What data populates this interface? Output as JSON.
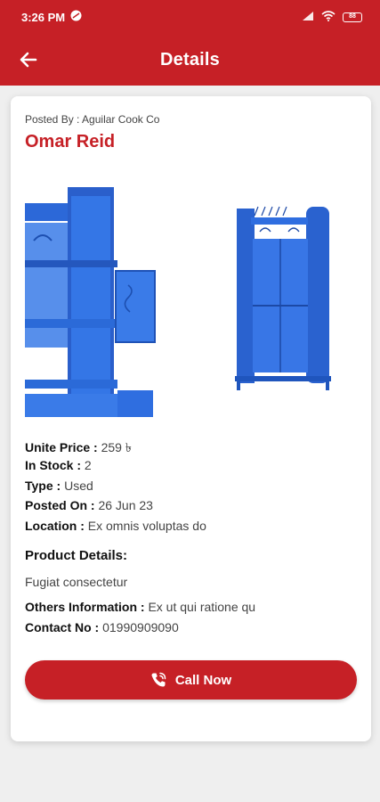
{
  "status_bar": {
    "time": "3:26 PM",
    "battery": "88"
  },
  "header": {
    "title": "Details"
  },
  "post": {
    "posted_by_label": "Posted By : ",
    "posted_by": "Aguilar Cook Co",
    "seller_name": "Omar Reid",
    "unit_price_label": "Unite Price : ",
    "unit_price": "259 ৳",
    "in_stock_label": "In Stock : ",
    "in_stock": "2",
    "type_label": "Type : ",
    "type": "Used",
    "posted_on_label": "Posted On : ",
    "posted_on": "26 Jun 23",
    "location_label": "Location : ",
    "location": "Ex omnis voluptas do",
    "product_details_label": "Product Details:",
    "product_details": "Fugiat consectetur",
    "others_info_label": "Others Information : ",
    "others_info": "Ex ut qui ratione qu",
    "contact_label": "Contact No : ",
    "contact": "01990909090"
  },
  "actions": {
    "call_label": "Call Now"
  },
  "icons": {
    "back": "arrow-left-icon",
    "call": "phone-call-icon"
  },
  "colors": {
    "brand": "#c62026",
    "product_blue": "#2b6fe0"
  }
}
